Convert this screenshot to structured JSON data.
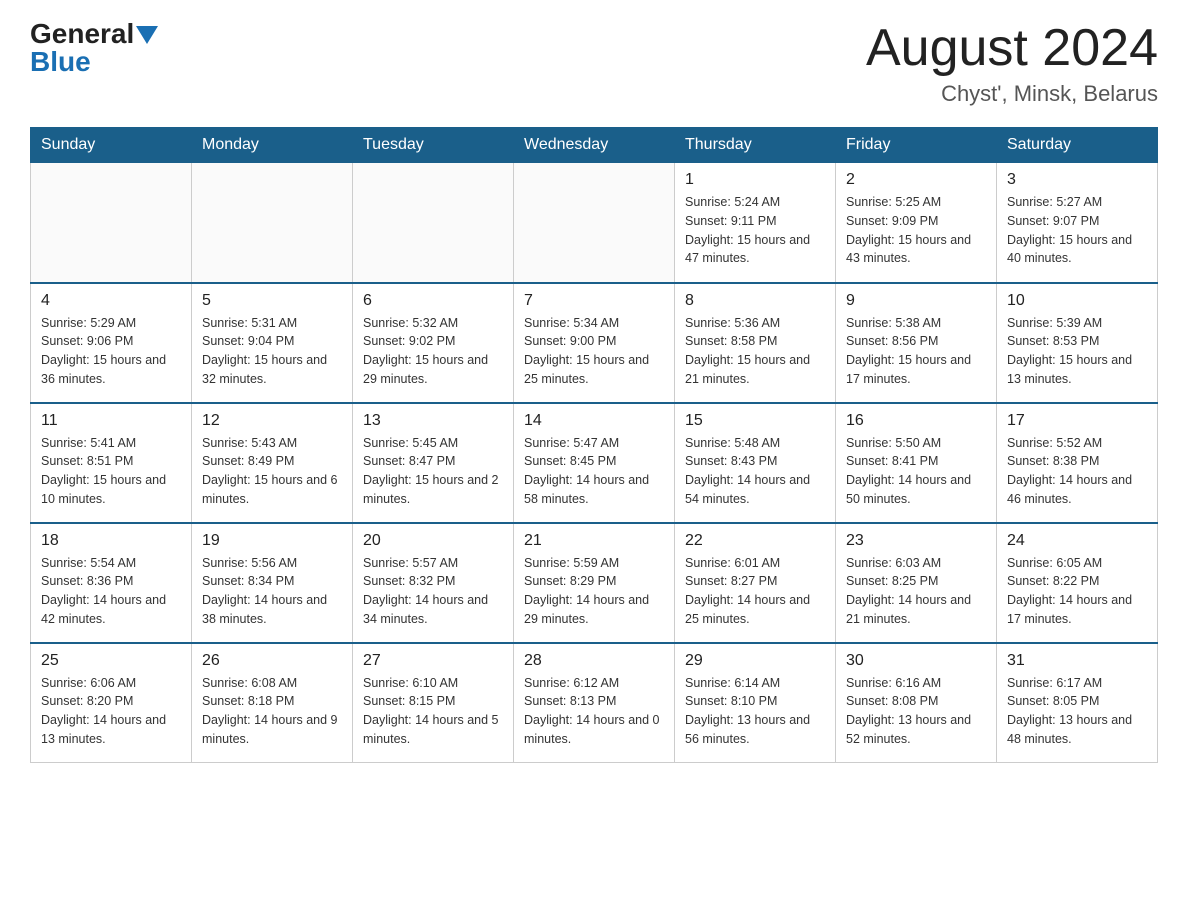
{
  "header": {
    "logo_general": "General",
    "logo_blue": "Blue",
    "month_title": "August 2024",
    "location": "Chyst', Minsk, Belarus"
  },
  "days_of_week": [
    "Sunday",
    "Monday",
    "Tuesday",
    "Wednesday",
    "Thursday",
    "Friday",
    "Saturday"
  ],
  "weeks": [
    [
      {
        "day": "",
        "info": ""
      },
      {
        "day": "",
        "info": ""
      },
      {
        "day": "",
        "info": ""
      },
      {
        "day": "",
        "info": ""
      },
      {
        "day": "1",
        "info": "Sunrise: 5:24 AM\nSunset: 9:11 PM\nDaylight: 15 hours and 47 minutes."
      },
      {
        "day": "2",
        "info": "Sunrise: 5:25 AM\nSunset: 9:09 PM\nDaylight: 15 hours and 43 minutes."
      },
      {
        "day": "3",
        "info": "Sunrise: 5:27 AM\nSunset: 9:07 PM\nDaylight: 15 hours and 40 minutes."
      }
    ],
    [
      {
        "day": "4",
        "info": "Sunrise: 5:29 AM\nSunset: 9:06 PM\nDaylight: 15 hours and 36 minutes."
      },
      {
        "day": "5",
        "info": "Sunrise: 5:31 AM\nSunset: 9:04 PM\nDaylight: 15 hours and 32 minutes."
      },
      {
        "day": "6",
        "info": "Sunrise: 5:32 AM\nSunset: 9:02 PM\nDaylight: 15 hours and 29 minutes."
      },
      {
        "day": "7",
        "info": "Sunrise: 5:34 AM\nSunset: 9:00 PM\nDaylight: 15 hours and 25 minutes."
      },
      {
        "day": "8",
        "info": "Sunrise: 5:36 AM\nSunset: 8:58 PM\nDaylight: 15 hours and 21 minutes."
      },
      {
        "day": "9",
        "info": "Sunrise: 5:38 AM\nSunset: 8:56 PM\nDaylight: 15 hours and 17 minutes."
      },
      {
        "day": "10",
        "info": "Sunrise: 5:39 AM\nSunset: 8:53 PM\nDaylight: 15 hours and 13 minutes."
      }
    ],
    [
      {
        "day": "11",
        "info": "Sunrise: 5:41 AM\nSunset: 8:51 PM\nDaylight: 15 hours and 10 minutes."
      },
      {
        "day": "12",
        "info": "Sunrise: 5:43 AM\nSunset: 8:49 PM\nDaylight: 15 hours and 6 minutes."
      },
      {
        "day": "13",
        "info": "Sunrise: 5:45 AM\nSunset: 8:47 PM\nDaylight: 15 hours and 2 minutes."
      },
      {
        "day": "14",
        "info": "Sunrise: 5:47 AM\nSunset: 8:45 PM\nDaylight: 14 hours and 58 minutes."
      },
      {
        "day": "15",
        "info": "Sunrise: 5:48 AM\nSunset: 8:43 PM\nDaylight: 14 hours and 54 minutes."
      },
      {
        "day": "16",
        "info": "Sunrise: 5:50 AM\nSunset: 8:41 PM\nDaylight: 14 hours and 50 minutes."
      },
      {
        "day": "17",
        "info": "Sunrise: 5:52 AM\nSunset: 8:38 PM\nDaylight: 14 hours and 46 minutes."
      }
    ],
    [
      {
        "day": "18",
        "info": "Sunrise: 5:54 AM\nSunset: 8:36 PM\nDaylight: 14 hours and 42 minutes."
      },
      {
        "day": "19",
        "info": "Sunrise: 5:56 AM\nSunset: 8:34 PM\nDaylight: 14 hours and 38 minutes."
      },
      {
        "day": "20",
        "info": "Sunrise: 5:57 AM\nSunset: 8:32 PM\nDaylight: 14 hours and 34 minutes."
      },
      {
        "day": "21",
        "info": "Sunrise: 5:59 AM\nSunset: 8:29 PM\nDaylight: 14 hours and 29 minutes."
      },
      {
        "day": "22",
        "info": "Sunrise: 6:01 AM\nSunset: 8:27 PM\nDaylight: 14 hours and 25 minutes."
      },
      {
        "day": "23",
        "info": "Sunrise: 6:03 AM\nSunset: 8:25 PM\nDaylight: 14 hours and 21 minutes."
      },
      {
        "day": "24",
        "info": "Sunrise: 6:05 AM\nSunset: 8:22 PM\nDaylight: 14 hours and 17 minutes."
      }
    ],
    [
      {
        "day": "25",
        "info": "Sunrise: 6:06 AM\nSunset: 8:20 PM\nDaylight: 14 hours and 13 minutes."
      },
      {
        "day": "26",
        "info": "Sunrise: 6:08 AM\nSunset: 8:18 PM\nDaylight: 14 hours and 9 minutes."
      },
      {
        "day": "27",
        "info": "Sunrise: 6:10 AM\nSunset: 8:15 PM\nDaylight: 14 hours and 5 minutes."
      },
      {
        "day": "28",
        "info": "Sunrise: 6:12 AM\nSunset: 8:13 PM\nDaylight: 14 hours and 0 minutes."
      },
      {
        "day": "29",
        "info": "Sunrise: 6:14 AM\nSunset: 8:10 PM\nDaylight: 13 hours and 56 minutes."
      },
      {
        "day": "30",
        "info": "Sunrise: 6:16 AM\nSunset: 8:08 PM\nDaylight: 13 hours and 52 minutes."
      },
      {
        "day": "31",
        "info": "Sunrise: 6:17 AM\nSunset: 8:05 PM\nDaylight: 13 hours and 48 minutes."
      }
    ]
  ]
}
